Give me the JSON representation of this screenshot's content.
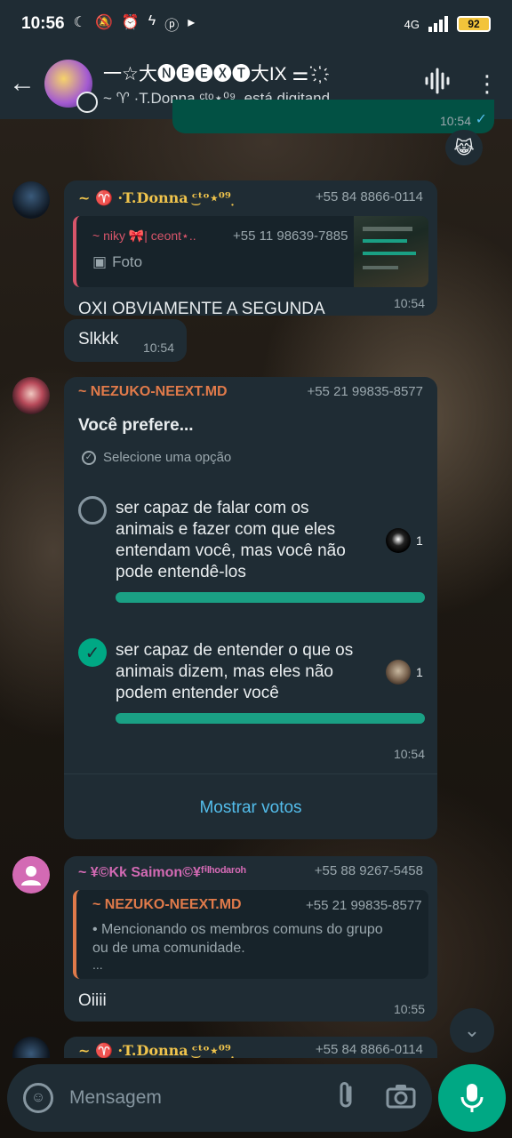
{
  "status": {
    "time": "10:56",
    "network": "4G",
    "battery": "92"
  },
  "header": {
    "title": "⼀☆⼤🅝🅔🅔🅧🅣⼤IX ⚌˙ ҉",
    "subtitle": "~ ♈ ·T.Donna ͜ᶜᵗᵒ⋆⁰⁹ ̣ está digitand..."
  },
  "top_partial": {
    "time": "10:54",
    "reaction": "😹"
  },
  "messages": [
    {
      "sender": "~ ♈ ·T.Donna ͜ᶜᵗᵒ⋆⁰⁹ ̣",
      "phone": "+55 84 8866-0114",
      "quote": {
        "sender": "~ niky 🎀| ceont⋆..",
        "phone": "+55 11 98639-7885",
        "label": "Foto"
      },
      "text": "OXI OBVIAMENTE A SEGUNDA",
      "time": "10:54"
    },
    {
      "text": "Slkkk",
      "time": "10:54"
    }
  ],
  "poll": {
    "sender": "~ NEZUKO-NEEXT.MD",
    "phone": "+55 21 99835-8577",
    "question": "Você prefere...",
    "hint": "Selecione uma opção",
    "options": [
      {
        "text": "ser capaz de falar com os animais e fazer com que eles entendam você, mas você não pode entendê-los",
        "votes": "1",
        "share": 1.0,
        "selected": false
      },
      {
        "text": "ser capaz de entender o que os animais dizem, mas eles não podem entender você",
        "votes": "1",
        "share": 1.0,
        "selected": true
      }
    ],
    "time": "10:54",
    "show_votes": "Mostrar votos"
  },
  "reply_message": {
    "sender": "~ ¥©Kk Saimon©¥ᶠⁱˡʰᵒᵈᵃʳᵒʰ",
    "phone": "+55 88 9267-5458",
    "quote": {
      "sender": "~ NEZUKO-NEEXT.MD",
      "phone": "+55 21 99835-8577",
      "text": "• Mencionando os membros comuns do grupo ou de uma comunidade.",
      "more": "..."
    },
    "text": "Oiiii",
    "time": "10:55"
  },
  "bottom_partial": {
    "sender": "~ ♈ ·T.Donna ͜ᶜᵗᵒ⋆⁰⁹ ̣",
    "phone": "+55 84 8866-0114"
  },
  "composer": {
    "placeholder": "Mensagem"
  },
  "colors": {
    "accent": "#00a884",
    "poll_bar": "#1aa084",
    "bubble": "#1f2c34",
    "outgoing": "#025144",
    "link": "#53bdeb"
  }
}
